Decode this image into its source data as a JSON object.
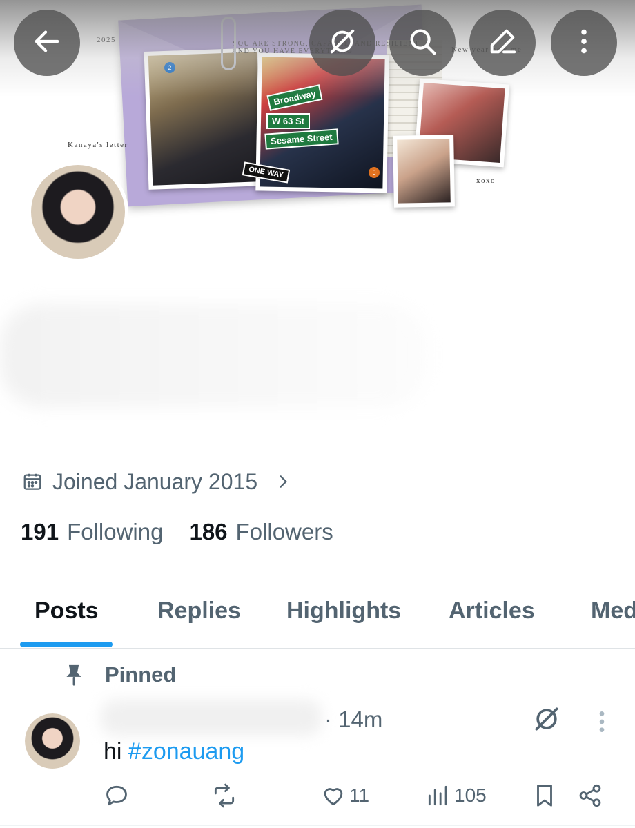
{
  "banner": {
    "year_text": "2025",
    "letter_text": "Kanaya's letter",
    "quote_text": "YOU ARE STRONG, CAPABLE, AND RESILIENT AND YOU HAVE EVERYTHING",
    "newyear_text": "New year new me",
    "xoxo_text": "xoxo",
    "signs": [
      "Broadway",
      "W 63 St",
      "Sesame Street",
      "ONE WAY"
    ],
    "badges": [
      "2",
      "5"
    ]
  },
  "top_actions": [
    "back-icon",
    "grok-icon",
    "search-icon",
    "edit-icon",
    "more-vertical-icon"
  ],
  "profile": {
    "joined": "Joined January 2015",
    "following_count": "191",
    "following_label": "Following",
    "followers_count": "186",
    "followers_label": "Followers"
  },
  "tabs": [
    {
      "label": "Posts",
      "active": true
    },
    {
      "label": "Replies",
      "active": false
    },
    {
      "label": "Highlights",
      "active": false
    },
    {
      "label": "Articles",
      "active": false
    },
    {
      "label": "Media",
      "active": false
    }
  ],
  "post": {
    "pinned_label": "Pinned",
    "time": "· 14m",
    "text_prefix": "hi ",
    "hashtag": "#zonauang",
    "likes": "11",
    "views": "105"
  },
  "colors": {
    "accent": "#1d9bf0",
    "secondary_text": "#536471",
    "primary_text": "#0f1419",
    "overlay_button": "#505050"
  }
}
